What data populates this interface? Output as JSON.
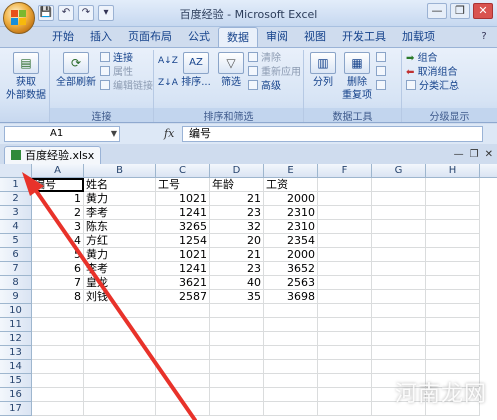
{
  "window": {
    "title": "百度经验 - Microsoft Excel",
    "minimize": "—",
    "restore": "❐",
    "close": "✕"
  },
  "quick_access": [
    "💾",
    "↶",
    "↷",
    "▾"
  ],
  "tabs": [
    "开始",
    "插入",
    "页面布局",
    "公式",
    "数据",
    "审阅",
    "视图",
    "开发工具",
    "加载项"
  ],
  "active_tab": "数据",
  "ribbon": {
    "get_external": "获取\n外部数据",
    "refresh_all": "全部刷新",
    "conn_items": [
      "连接",
      "属性",
      "编辑链接"
    ],
    "conn_group": "连接",
    "sort_label": "排序...",
    "filter_label": "筛选",
    "filter_items": [
      "清除",
      "重新应用",
      "高级"
    ],
    "sort_group": "排序和筛选",
    "split_label": "分列",
    "dedupe_label": "删除\n重复项",
    "tools_group": "数据工具",
    "outline_items": [
      "组合",
      "取消组合",
      "分类汇总"
    ],
    "outline_group": "分级显示"
  },
  "formula_bar": {
    "name_box": "A1",
    "fx": "fx",
    "content": "编号"
  },
  "workbook": {
    "name": "百度经验.xlsx"
  },
  "columns": [
    "A",
    "B",
    "C",
    "D",
    "E",
    "F",
    "G",
    "H"
  ],
  "rows": [
    "1",
    "2",
    "3",
    "4",
    "5",
    "6",
    "7",
    "8",
    "9",
    "10",
    "11",
    "12",
    "13",
    "14",
    "15",
    "16",
    "17"
  ],
  "cells": [
    [
      "编号",
      "姓名",
      "工号",
      "年龄",
      "工资"
    ],
    [
      "1",
      "黄力",
      "1021",
      "21",
      "2000"
    ],
    [
      "2",
      "李考",
      "1241",
      "23",
      "2310"
    ],
    [
      "3",
      "陈东",
      "3265",
      "32",
      "2310"
    ],
    [
      "4",
      "方红",
      "1254",
      "20",
      "2354"
    ],
    [
      "5",
      "黄力",
      "1021",
      "21",
      "2000"
    ],
    [
      "6",
      "李考",
      "1241",
      "23",
      "3652"
    ],
    [
      "7",
      "皇龙",
      "3621",
      "40",
      "2563"
    ],
    [
      "8",
      "刘钱",
      "2587",
      "35",
      "3698"
    ]
  ],
  "watermark": "河南龙网",
  "colors": {
    "arrow": "#e8322a",
    "ribbon_text": "#15428b",
    "excel_green": "#2f8a3a"
  }
}
